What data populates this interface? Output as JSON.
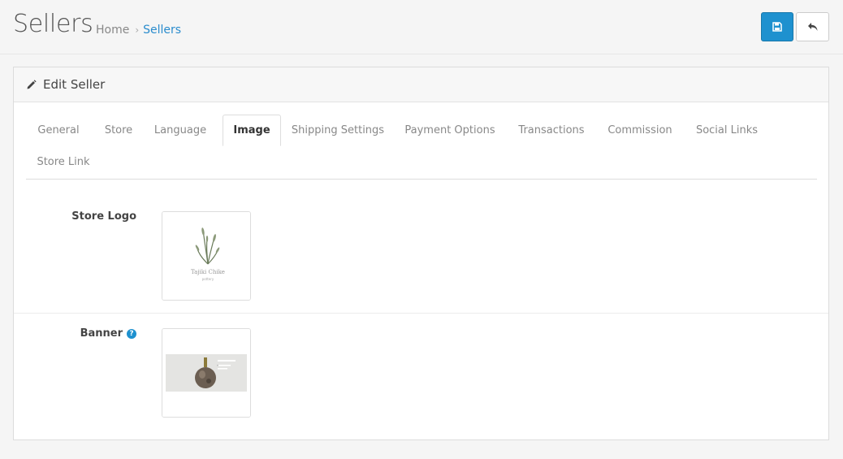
{
  "header": {
    "title": "Sellers",
    "breadcrumb": {
      "home": "Home",
      "separator": "›",
      "current": "Sellers"
    },
    "save_icon": "floppy-disk-icon",
    "back_icon": "reply-arrow-icon"
  },
  "panel": {
    "icon": "pencil-icon",
    "title": "Edit Seller"
  },
  "tabs": [
    {
      "label": "General",
      "active": false
    },
    {
      "label": "Store",
      "active": false
    },
    {
      "label": "Language",
      "active": false
    },
    {
      "label": "Image",
      "active": true
    },
    {
      "label": "Shipping Settings",
      "active": false
    },
    {
      "label": "Payment Options",
      "active": false
    },
    {
      "label": "Transactions",
      "active": false
    },
    {
      "label": "Commission",
      "active": false
    },
    {
      "label": "Social Links",
      "active": false
    },
    {
      "label": "Store Link",
      "active": false
    }
  ],
  "fields": {
    "store_logo": {
      "label": "Store Logo",
      "image_caption": "Tajiki Chike",
      "image_subcaption": "pottery"
    },
    "banner": {
      "label": "Banner",
      "help_icon": "question-circle-icon",
      "help_glyph": "?"
    }
  },
  "colors": {
    "primary": "#1e91cf",
    "link": "#2a8ccd",
    "page_bg": "#f5f5f5"
  }
}
